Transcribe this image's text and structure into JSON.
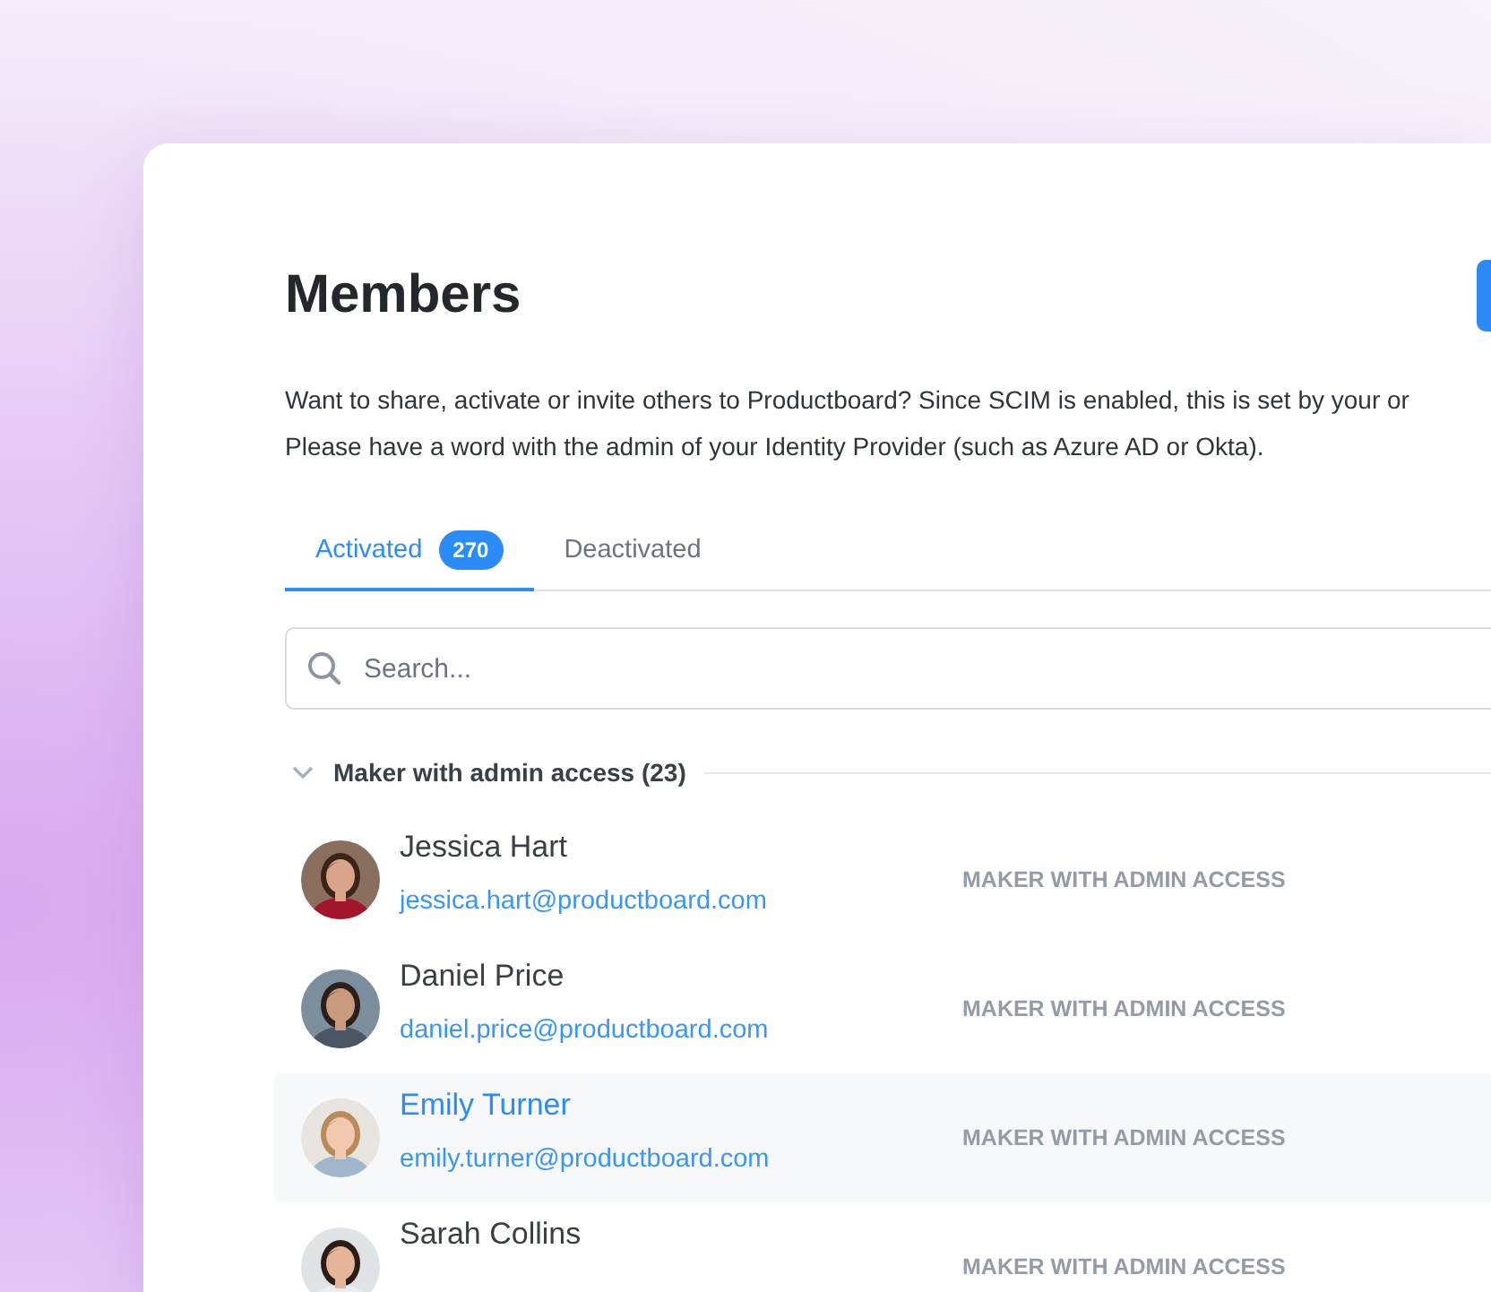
{
  "page": {
    "title": "Members",
    "description": [
      "Want to share, activate or invite others to Productboard? Since SCIM is enabled, this is set by your or",
      "Please have a word with the admin of your Identity Provider (such as Azure AD or Okta)."
    ]
  },
  "tabs": [
    {
      "label": "Activated",
      "count": "270",
      "selected": true
    },
    {
      "label": "Deactivated",
      "selected": false
    }
  ],
  "search": {
    "placeholder": "Search..."
  },
  "group": {
    "title": "Maker with admin access (23)",
    "expanded": true
  },
  "members": [
    {
      "name": "Jessica Hart",
      "email": "jessica.hart@productboard.com",
      "role": "MAKER WITH ADMIN ACCESS",
      "selected": false
    },
    {
      "name": "Daniel Price",
      "email": "daniel.price@productboard.com",
      "role": "MAKER WITH ADMIN ACCESS",
      "selected": false
    },
    {
      "name": "Emily Turner",
      "email": "emily.turner@productboard.com",
      "role": "MAKER WITH ADMIN ACCESS",
      "selected": true
    },
    {
      "name": "Sarah Collins",
      "role": "MAKER WITH ADMIN ACCESS",
      "selected": false
    }
  ]
}
